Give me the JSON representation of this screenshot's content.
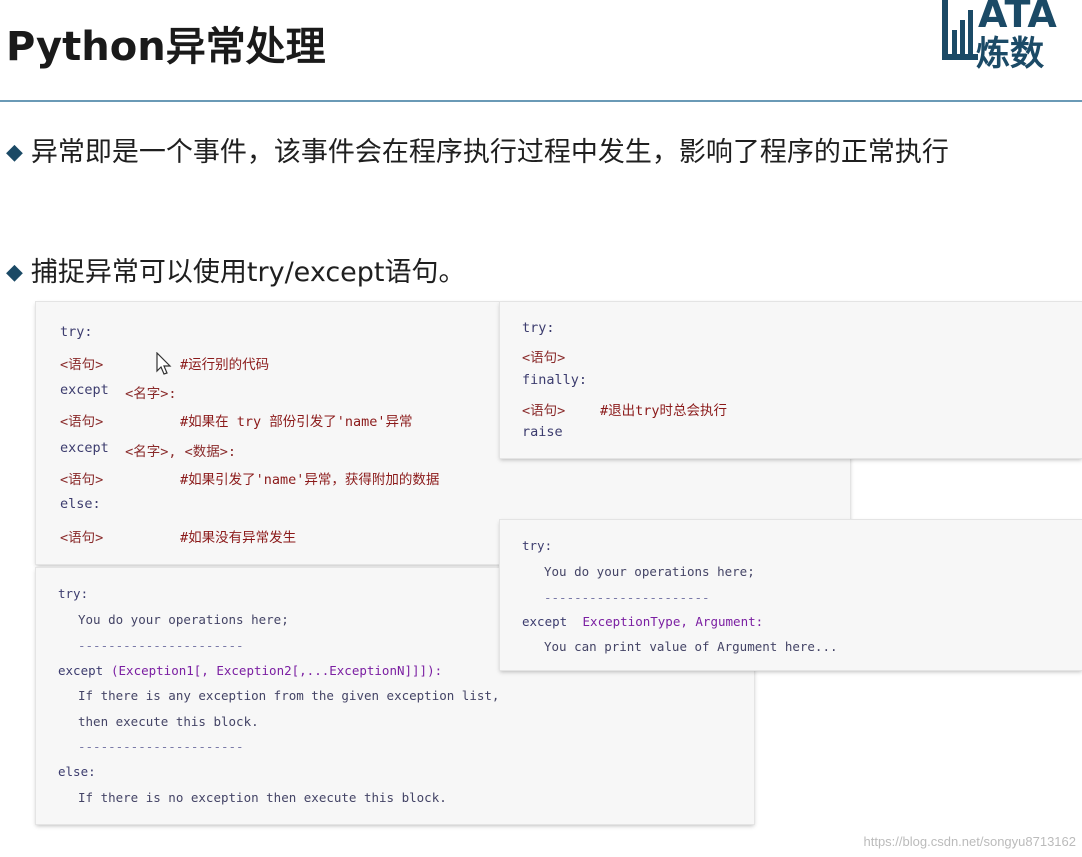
{
  "title": "Python异常处理",
  "logo": {
    "line1": "ATA",
    "line2": "炼数"
  },
  "bullets": [
    "异常即是一个事件，该事件会在程序执行过程中发生，影响了程序的正常执行",
    "捕捉异常可以使用try/except语句。"
  ],
  "box1": {
    "l1": "try:",
    "l2a": "<语句>",
    "l2b": "#运行别的代码",
    "l3a": "except",
    "l3b": " <名字>:",
    "l4a": "<语句>",
    "l4b": "#如果在 try 部份引发了'name'异常",
    "l5a": "except",
    "l5b": " <名字>, <数据>:",
    "l6a": "<语句>",
    "l6b": "#如果引发了'name'异常，获得附加的数据",
    "l7": "else:",
    "l8a": "<语句>",
    "l8b": "#如果没有异常发生"
  },
  "box2": {
    "l1": "try:",
    "l2": "<语句>",
    "l3": "finally:",
    "l4a": "<语句>",
    "l4b": "#退出try时总会执行",
    "l5": "raise"
  },
  "box3": {
    "l1": "try:",
    "l2": "You do your operations here;",
    "l3": "----------------------",
    "l4a": "except",
    "l4b": "(Exception1[, Exception2[,...ExceptionN]]]):",
    "l5": "If there is any exception from the given exception list,",
    "l6": "then execute this block.",
    "l7": "----------------------",
    "l8": "else:",
    "l9": "If there is no exception then execute this block."
  },
  "box4": {
    "l1": "try:",
    "l2": "You do your operations here;",
    "l3": "----------------------",
    "l4a": "except",
    "l4b": " ExceptionType, Argument:",
    "l5": "You can print value of Argument here..."
  },
  "watermark": "https://blog.csdn.net/songyu8713162"
}
